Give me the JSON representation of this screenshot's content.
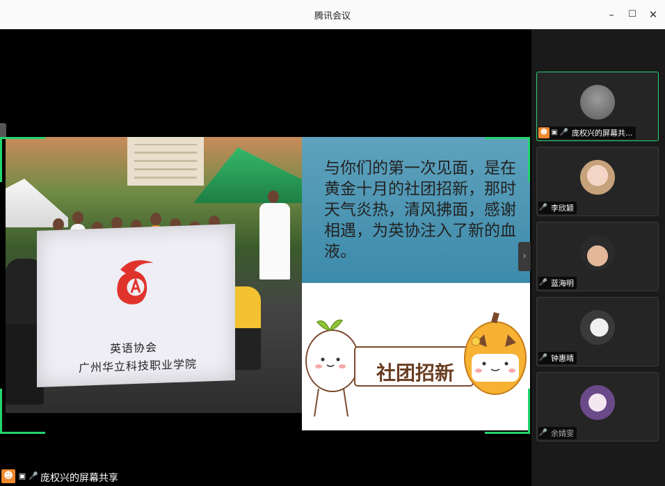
{
  "window": {
    "title": "腾讯会议",
    "minimize_label": "–",
    "maximize_label": "☐",
    "close_label": "✕"
  },
  "share": {
    "slide_text": "与你们的第一次见面，是在黄金十月的社团招新，那时天气炎热，清风拂面，感谢相遇，为英协注入了新的血液。",
    "banner_text": "社团招新",
    "flag_line1": "英语协会",
    "flag_line2": "广州华立科技职业学院",
    "collapse_label": "›"
  },
  "bottom_bar": {
    "sharer_label": "庞权兴的屏幕共享"
  },
  "participants": [
    {
      "name": "庞权兴的屏幕共...",
      "mic": "on",
      "sharing": true,
      "active": true
    },
    {
      "name": "李欣颖",
      "mic": "muted",
      "sharing": false,
      "active": false
    },
    {
      "name": "蓝海明",
      "mic": "on",
      "sharing": false,
      "active": false
    },
    {
      "name": "钟惠晴",
      "mic": "muted",
      "sharing": false,
      "active": false
    },
    {
      "name": "余婧雯",
      "mic": "muted",
      "sharing": false,
      "active": false
    }
  ],
  "colors": {
    "accent_green": "#22d56e",
    "orange": "#f0882c",
    "muted_red": "#e04848"
  }
}
